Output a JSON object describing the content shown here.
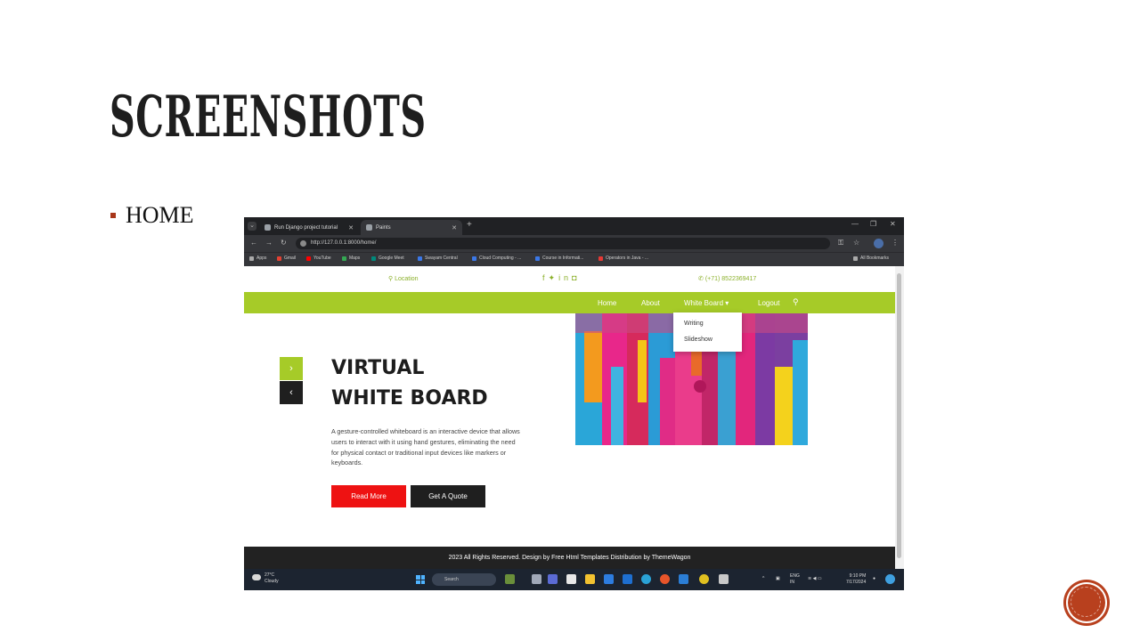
{
  "slide": {
    "title": "SCREENSHOTS",
    "bullet": "HOME",
    "accent_color": "#a8361a"
  },
  "browser": {
    "tabs": [
      {
        "label": "Run Django project tutorial"
      },
      {
        "label": "Paints"
      }
    ],
    "address": "http://127.0.0.1:8000/home/",
    "bookmarks": [
      "Apps",
      "Gmail",
      "YouTube",
      "Maps",
      "Google Meet",
      "Swayam Central",
      "Cloud Computing - ...",
      "Course in Informati...",
      "Operators in Java - ..."
    ],
    "all_bookmarks": "All Bookmarks"
  },
  "site": {
    "location": "Location",
    "phone": "(+71) 8522369417",
    "nav": {
      "home": "Home",
      "about": "About",
      "whiteboard": "White Board",
      "logout": "Logout"
    },
    "dropdown": [
      "Writing",
      "Slideshow"
    ],
    "hero": {
      "title_line1": "VIRTUAL",
      "title_line2": "WHITE BOARD",
      "description": "A gesture-controlled whiteboard is an interactive device that allows users to interact with it using hand gestures, eliminating the need for physical contact or traditional input devices like markers or keyboards.",
      "read_more": "Read More",
      "get_quote": "Get A Quote"
    },
    "footer": "2023 All Rights Reserved. Design by Free Html Templates Distribution by ThemeWagon",
    "colors": {
      "brand_green": "#a6cb28",
      "red": "#ee1212",
      "dark": "#1f1f1f"
    }
  },
  "taskbar": {
    "temperature": "27°C",
    "weather": "Cloudy",
    "search": "Search",
    "lang": "ENG",
    "region": "IN",
    "time": "9:10 PM",
    "date": "7/17/2024"
  }
}
